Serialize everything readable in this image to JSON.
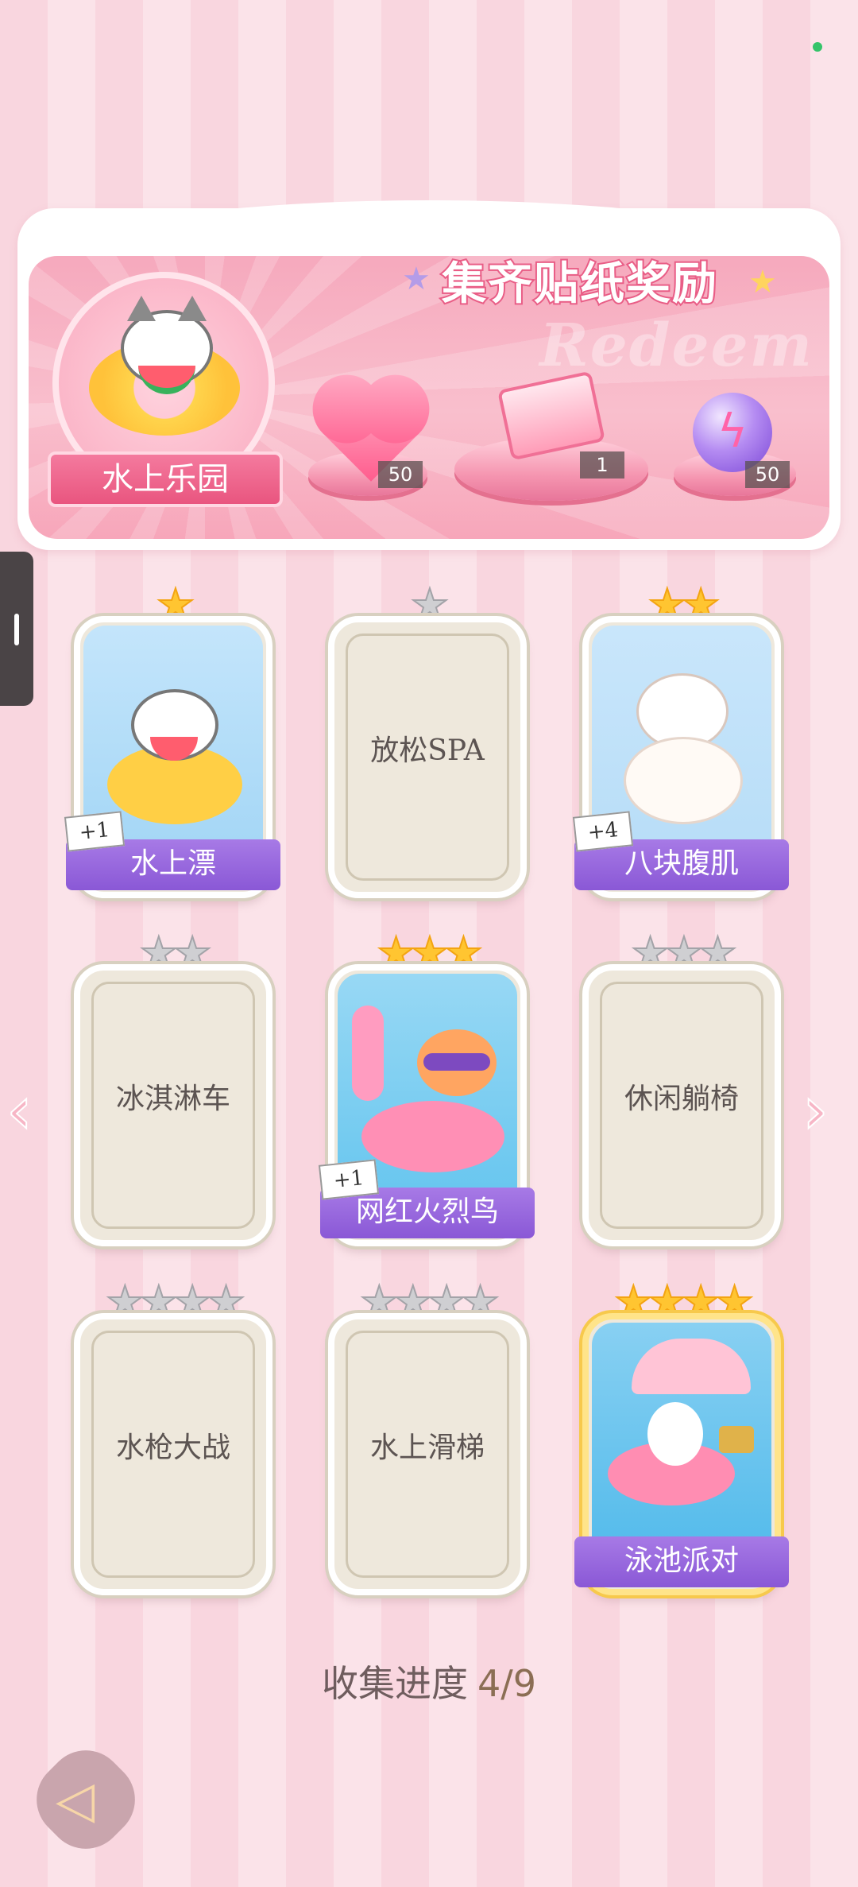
{
  "banner": {
    "title": "集齐贴纸奖励",
    "watermark": "Redeem",
    "album_name": "水上乐园",
    "rewards": [
      {
        "icon": "heart-gem-icon",
        "count": "50"
      },
      {
        "icon": "gift-box-icon",
        "count": "1"
      },
      {
        "icon": "energy-orb-icon",
        "count": "50"
      }
    ]
  },
  "cards": [
    {
      "name": "水上漂",
      "stars": 1,
      "collected": true,
      "duplicates": "+1"
    },
    {
      "name": "放松SPA",
      "stars": 1,
      "collected": false,
      "duplicates": ""
    },
    {
      "name": "八块腹肌",
      "stars": 2,
      "collected": true,
      "duplicates": "+4"
    },
    {
      "name": "冰淇淋车",
      "stars": 2,
      "collected": false,
      "duplicates": ""
    },
    {
      "name": "网红火烈鸟",
      "stars": 3,
      "collected": true,
      "duplicates": "+1"
    },
    {
      "name": "休闲躺椅",
      "stars": 3,
      "collected": false,
      "duplicates": ""
    },
    {
      "name": "水枪大战",
      "stars": 4,
      "collected": false,
      "duplicates": ""
    },
    {
      "name": "水上滑梯",
      "stars": 4,
      "collected": false,
      "duplicates": ""
    },
    {
      "name": "泳池派对",
      "stars": 4,
      "collected": true,
      "duplicates": ""
    }
  ],
  "progress": {
    "label": "收集进度",
    "value": "4/9"
  },
  "icons": {
    "nav_prev": "chevron-left-icon",
    "nav_next": "chevron-right-icon",
    "back": "back-arrow-icon"
  },
  "colors": {
    "ribbon": "#9a68de",
    "banner_pink": "#f6a9bd",
    "star_gold": "#ffc531",
    "star_grey": "#cfcfd2"
  }
}
